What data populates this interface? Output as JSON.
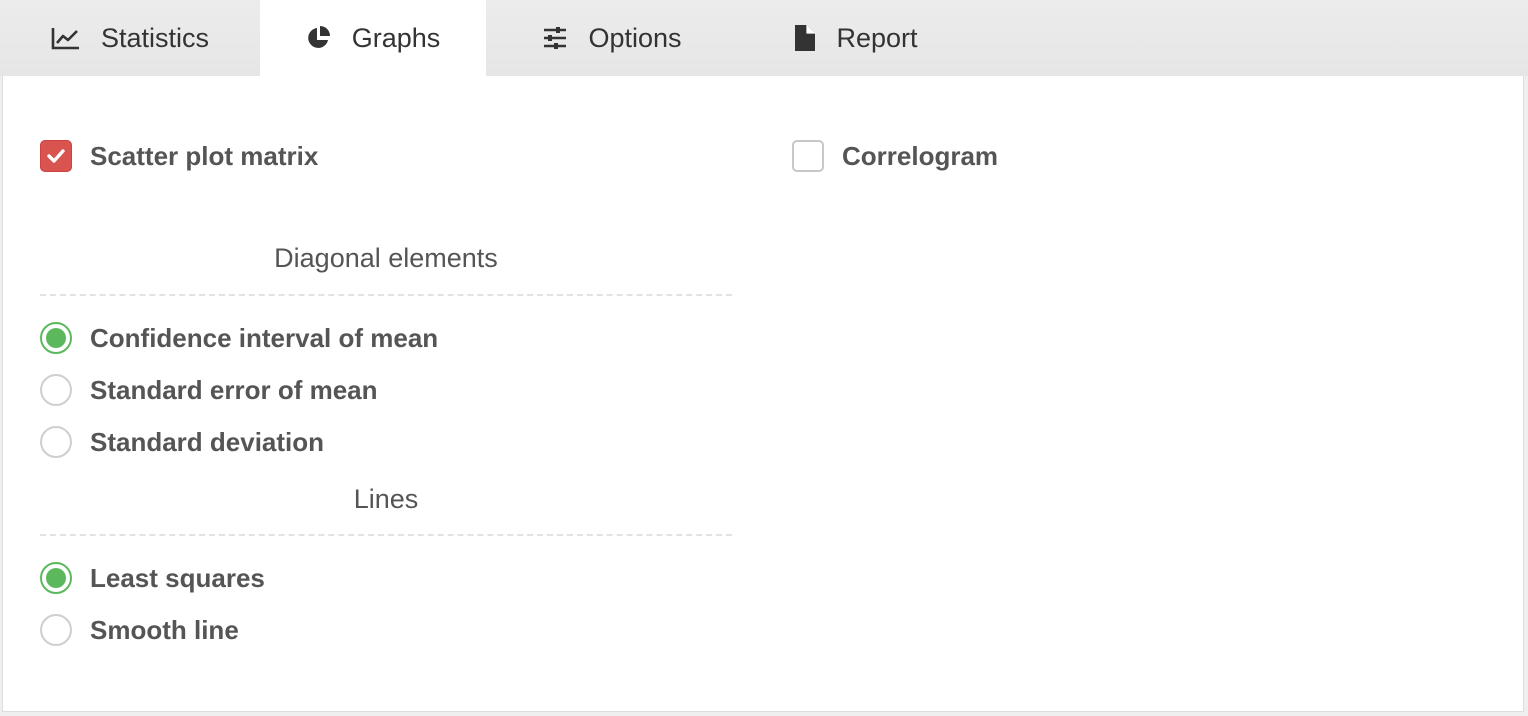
{
  "tabs": [
    {
      "label": "Statistics",
      "icon": "line-chart-icon",
      "active": false
    },
    {
      "label": "Graphs",
      "icon": "pie-chart-icon",
      "active": true
    },
    {
      "label": "Options",
      "icon": "sliders-icon",
      "active": false
    },
    {
      "label": "Report",
      "icon": "document-icon",
      "active": false
    }
  ],
  "graphs": {
    "scatter_plot_matrix": {
      "label": "Scatter plot matrix",
      "checked": true
    },
    "correlogram": {
      "label": "Correlogram",
      "checked": false
    },
    "diagonal_elements": {
      "title": "Diagonal elements",
      "options": [
        {
          "label": "Confidence interval of mean",
          "selected": true
        },
        {
          "label": "Standard error of mean",
          "selected": false
        },
        {
          "label": "Standard deviation",
          "selected": false
        }
      ]
    },
    "lines": {
      "title": "Lines",
      "options": [
        {
          "label": "Least squares",
          "selected": true
        },
        {
          "label": "Smooth line",
          "selected": false
        }
      ]
    }
  },
  "colors": {
    "checkbox_checked": "#d9534f",
    "radio_selected": "#5cb85c",
    "tab_active_bg": "#ffffff",
    "tabbar_bg": "#e8e8e8"
  }
}
